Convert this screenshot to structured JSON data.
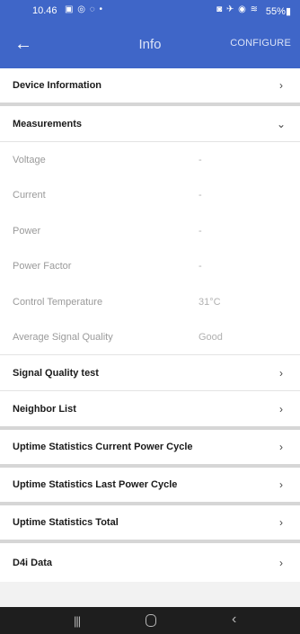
{
  "status_bar": {
    "time": "10.46",
    "left_icons": "▣ ◎ ◌ •",
    "right_icons": "◙ ✈ ◉ ≋",
    "battery": "55%▮"
  },
  "app_bar": {
    "back_icon": "←",
    "title": "Info",
    "configure_label": "CONFIGURE"
  },
  "sections": {
    "device_information": "Device Information",
    "measurements": "Measurements",
    "signal_quality_test": "Signal Quality test",
    "neighbor_list": "Neighbor List",
    "uptime_current": "Uptime Statistics Current Power Cycle",
    "uptime_last": "Uptime Statistics Last Power Cycle",
    "uptime_total": "Uptime Statistics Total",
    "d4i_data": "D4i Data"
  },
  "measurements": [
    {
      "label": "Voltage",
      "value": "-"
    },
    {
      "label": "Current",
      "value": "-"
    },
    {
      "label": "Power",
      "value": "-"
    },
    {
      "label": "Power Factor",
      "value": "-"
    },
    {
      "label": "Control Temperature",
      "value": "31°C"
    },
    {
      "label": "Average Signal Quality",
      "value": "Good"
    }
  ],
  "icons": {
    "chevron_right": "›",
    "chevron_down": "⌄"
  },
  "nav_bar": {
    "recent_icon": "|||",
    "back_icon": "‹"
  }
}
